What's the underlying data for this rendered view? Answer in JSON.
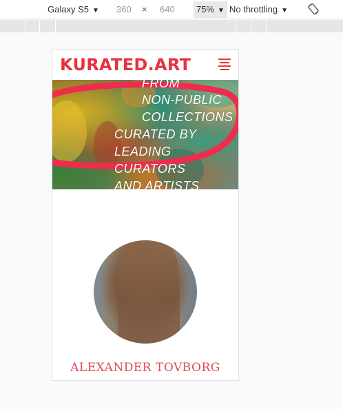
{
  "toolbar": {
    "device": "Galaxy S5",
    "width": "360",
    "times": "×",
    "height": "640",
    "zoom": "75%",
    "throttling": "No throttling",
    "caret_icon": "▼",
    "rotate_icon": "rotate-icon"
  },
  "site": {
    "logo": "KURATED.ART",
    "menu_icon": "hamburger-menu-icon",
    "accent": "#e8323f"
  },
  "hero": {
    "lines": [
      "FROM",
      "NON-PUBLIC",
      "COLLECTIONS",
      "CURATED BY",
      "LEADING",
      "CURATORS",
      "AND ARTISTS"
    ]
  },
  "artist": {
    "name": "ALEXANDER TOVBORG"
  }
}
